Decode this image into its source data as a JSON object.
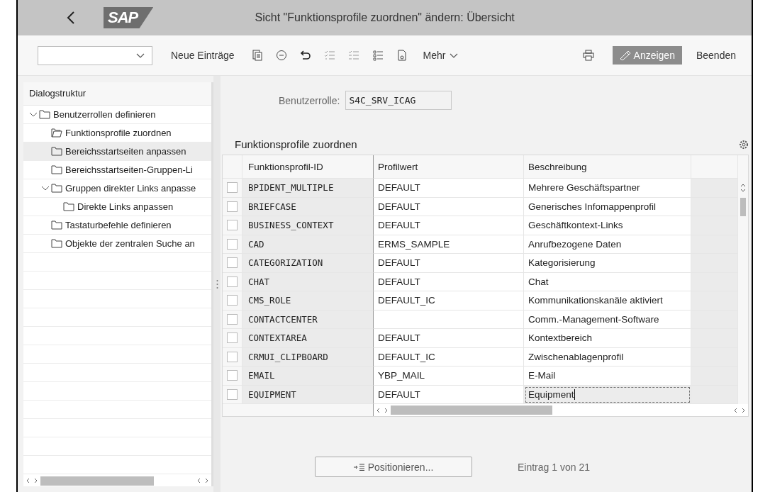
{
  "window": {
    "title": "Sicht \"Funktionsprofile zuordnen\" ändern: Übersicht",
    "logo": "SAP"
  },
  "toolbar": {
    "new_entries": "Neue Einträge",
    "more": "Mehr",
    "display": "Anzeigen",
    "exit": "Beenden"
  },
  "sidebar": {
    "title": "Dialogstruktur",
    "items": [
      {
        "label": "Benutzerrollen definieren",
        "expanded": true,
        "selected": false,
        "open": false,
        "children": [
          {
            "label": "Funktionsprofile zuordnen",
            "selected": false,
            "open": true
          },
          {
            "label": "Bereichsstartseiten anpassen",
            "selected": true,
            "open": false
          },
          {
            "label": "Bereichsstartseiten-Gruppen-Li",
            "selected": false,
            "open": false
          },
          {
            "label": "Gruppen direkter Links anpasse",
            "expanded": true,
            "selected": false,
            "open": false,
            "children": [
              {
                "label": "Direkte Links anpassen",
                "selected": false,
                "open": false
              }
            ]
          },
          {
            "label": "Tastaturbefehle definieren",
            "selected": false,
            "open": false
          },
          {
            "label": "Objekte der zentralen Suche an",
            "selected": false,
            "open": false
          }
        ]
      }
    ]
  },
  "form": {
    "label": "Benutzerrolle:",
    "value": "S4C_SRV_ICAG"
  },
  "table": {
    "title": "Funktionsprofile zuordnen",
    "columns": [
      "Funktionsprofil-ID",
      "Profilwert",
      "Beschreibung"
    ],
    "rows": [
      {
        "id": "BPIDENT_MULTIPLE",
        "value": "DEFAULT",
        "description": "Mehrere Geschäftspartner",
        "selected": false,
        "focused": false
      },
      {
        "id": "BRIEFCASE",
        "value": "DEFAULT",
        "description": "Generisches Infomappenprofil",
        "selected": false,
        "focused": false
      },
      {
        "id": "BUSINESS_CONTEXT",
        "value": "DEFAULT",
        "description": "Geschäftkontext-Links",
        "selected": false,
        "focused": false
      },
      {
        "id": "CAD",
        "value": "ERMS_SAMPLE",
        "description": "Anrufbezogene Daten",
        "selected": false,
        "focused": false
      },
      {
        "id": "CATEGORIZATION",
        "value": "DEFAULT",
        "description": "Kategorisierung",
        "selected": false,
        "focused": false
      },
      {
        "id": "CHAT",
        "value": "DEFAULT",
        "description": "Chat",
        "selected": false,
        "focused": false
      },
      {
        "id": "CMS_ROLE",
        "value": "DEFAULT_IC",
        "description": "Kommunikationskanäle aktiviert",
        "selected": false,
        "focused": false
      },
      {
        "id": "CONTACTCENTER",
        "description": "Comm.-Management-Software",
        "selected": false,
        "focused": false
      },
      {
        "id": "CONTEXTAREA",
        "value": "DEFAULT",
        "description": "Kontextbereich",
        "selected": false,
        "focused": false
      },
      {
        "id": "CRMUI_CLIPBOARD",
        "value": "DEFAULT_IC",
        "description": "Zwischenablagenprofil",
        "selected": false,
        "focused": false
      },
      {
        "id": "EMAIL",
        "value": "YBP_MAIL",
        "description": "E-Mail",
        "selected": false,
        "focused": false
      },
      {
        "id": "EQUIPMENT",
        "value": "DEFAULT",
        "description": "Equipment",
        "selected": false,
        "focused": true
      }
    ]
  },
  "footer": {
    "button": "Positionieren...",
    "entry": "Eintrag 1 von 21"
  }
}
